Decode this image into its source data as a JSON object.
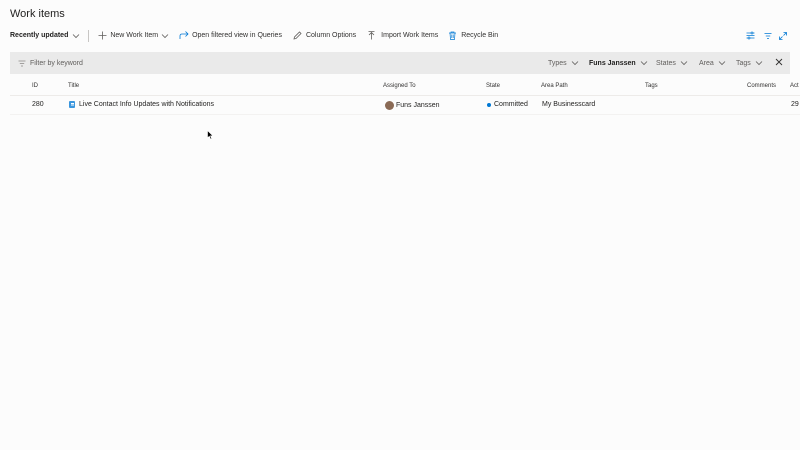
{
  "page": {
    "title": "Work items"
  },
  "toolbar": {
    "view_selector": "Recently updated",
    "new_work_item": "New Work Item",
    "open_in_queries": "Open filtered view in Queries",
    "column_options": "Column Options",
    "import_work_items": "Import Work Items",
    "recycle_bin": "Recycle Bin"
  },
  "filter": {
    "placeholder": "Filter by keyword",
    "types": "Types",
    "assigned": "Funs Janssen",
    "states": "States",
    "area": "Area",
    "tags": "Tags"
  },
  "grid": {
    "columns": [
      "ID",
      "Title",
      "Assigned To",
      "State",
      "Area Path",
      "Tags",
      "Comments",
      "Act"
    ],
    "rows": [
      {
        "id": "280",
        "title": "Live Contact Info Updates with Notifications",
        "assigned_to": "Funs Janssen",
        "state": "Committed",
        "area_path": "My Businesscard",
        "tags": "",
        "comments": "",
        "activity": "29"
      }
    ]
  },
  "colors": {
    "accent": "#0078d4",
    "work_item_icon": "#3a96dd",
    "filter_bar": "#eaeaea"
  }
}
